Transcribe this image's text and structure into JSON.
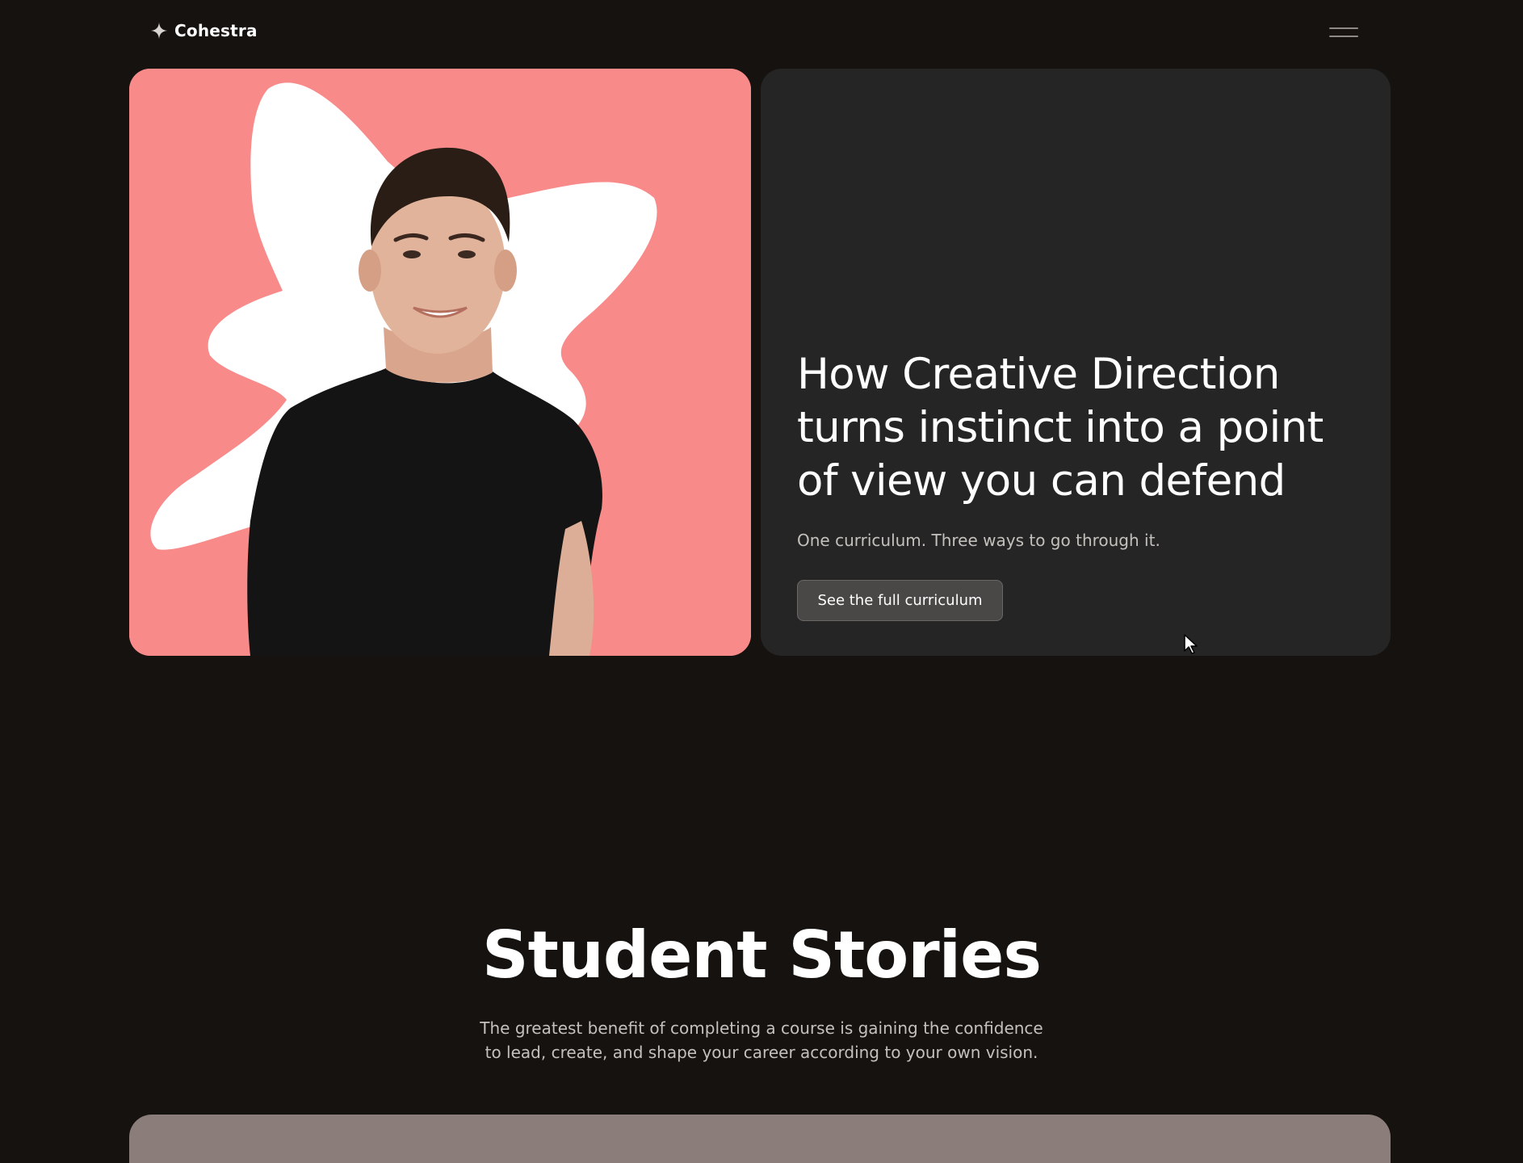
{
  "header": {
    "brand_name": "Cohestra",
    "logo_icon": "sparkle-star-icon",
    "menu_icon": "hamburger-menu-icon"
  },
  "hero": {
    "title": "How Creative Direction turns instinct into a point of view you can defend",
    "subtitle": "One curriculum. Three ways to go through it.",
    "cta_label": "See the full curriculum",
    "image_background_color": "#f88a8a",
    "card_background_color": "#262525"
  },
  "stories": {
    "title": "Student Stories",
    "description": "The greatest benefit of completing a course is gaining the confidence to lead, create, and shape your career according to your own vision.",
    "card_color": "#8b7d7a"
  },
  "colors": {
    "page_background": "#161210",
    "accent_pink": "#f88a8a"
  }
}
